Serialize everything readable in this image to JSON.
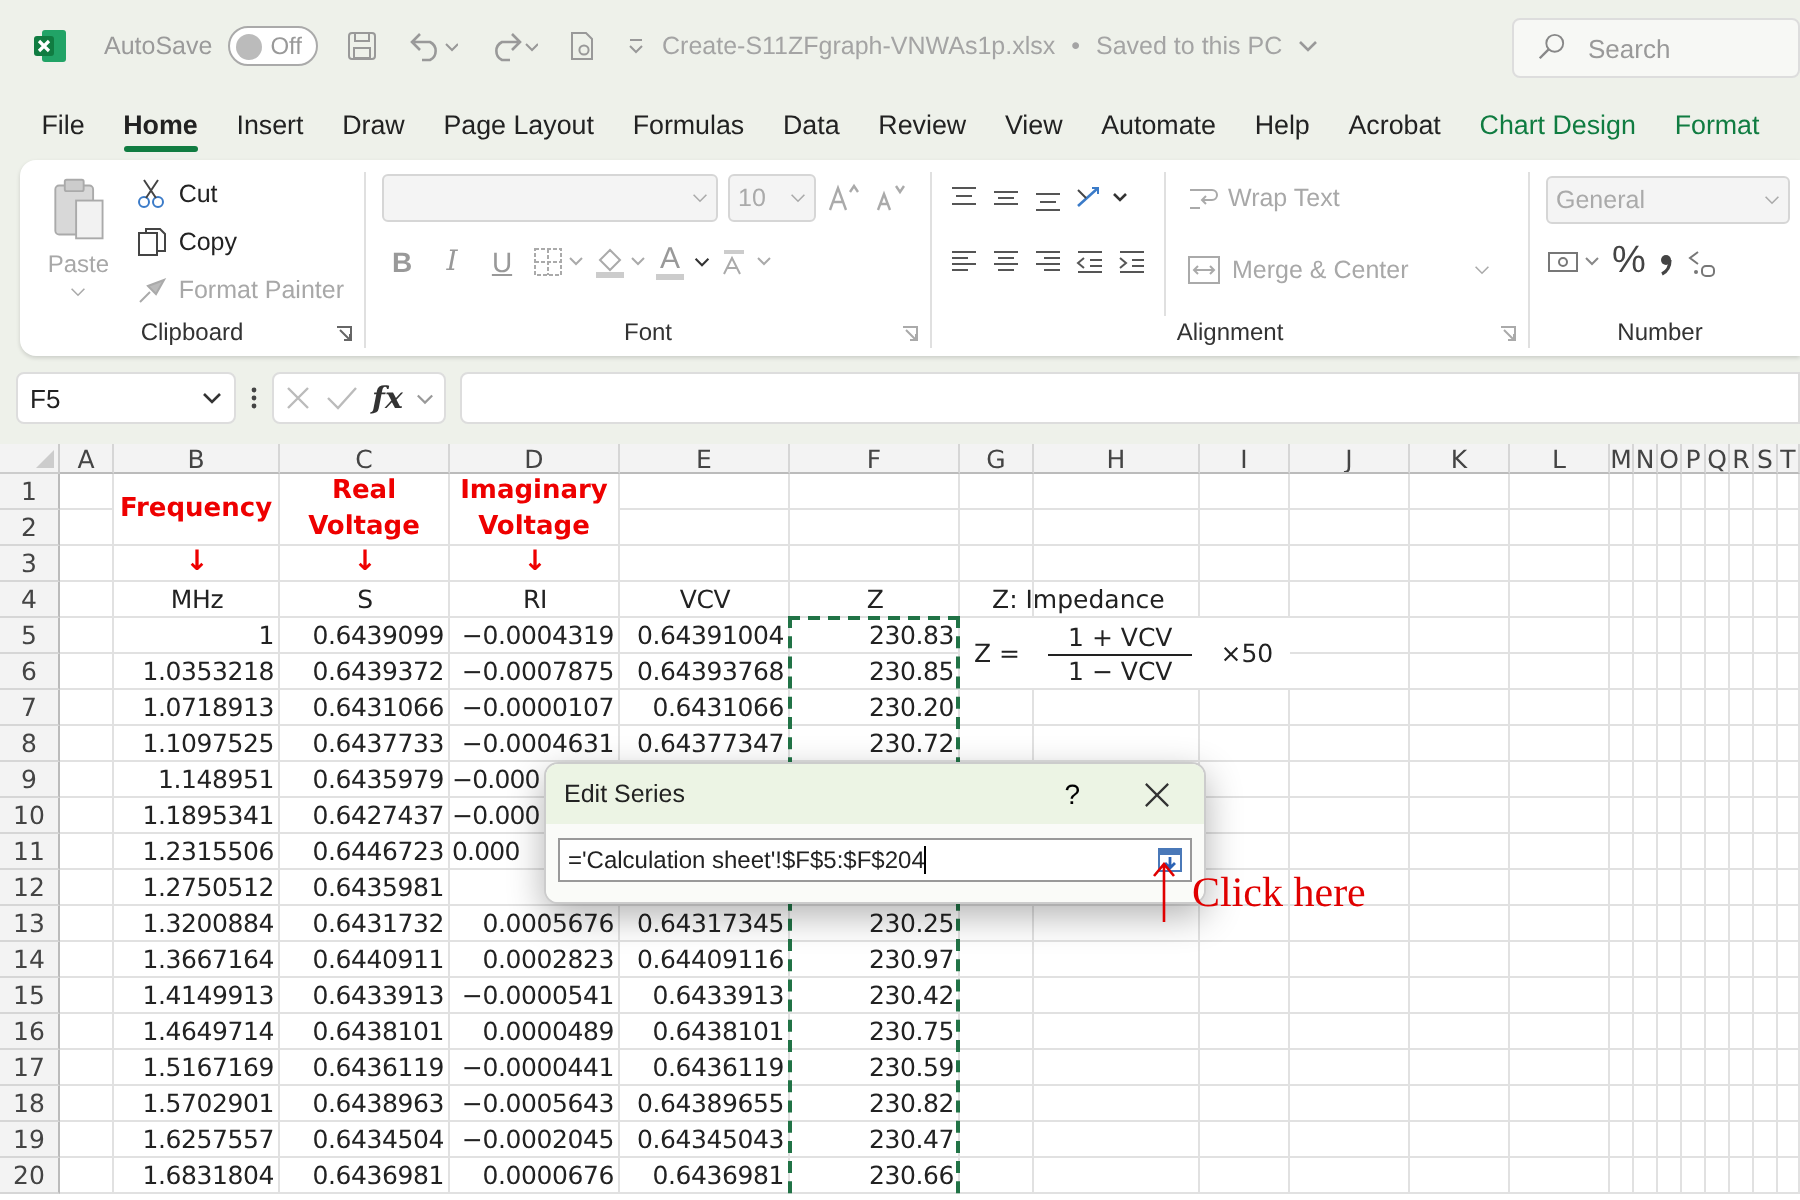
{
  "titlebar": {
    "autosave": "AutoSave",
    "autosave_state": "Off",
    "autosave_on": false,
    "filename": "Create-S11ZFgraph-VNWAs1p.xlsx",
    "separator": "•",
    "save_status": "Saved to this PC",
    "search": {
      "placeholder": "Search"
    }
  },
  "tabs": [
    {
      "label": "File",
      "selected": false,
      "contextual": false
    },
    {
      "label": "Home",
      "selected": true,
      "contextual": false
    },
    {
      "label": "Insert",
      "selected": false,
      "contextual": false
    },
    {
      "label": "Draw",
      "selected": false,
      "contextual": false
    },
    {
      "label": "Page Layout",
      "selected": false,
      "contextual": false
    },
    {
      "label": "Formulas",
      "selected": false,
      "contextual": false
    },
    {
      "label": "Data",
      "selected": false,
      "contextual": false
    },
    {
      "label": "Review",
      "selected": false,
      "contextual": false
    },
    {
      "label": "View",
      "selected": false,
      "contextual": false
    },
    {
      "label": "Automate",
      "selected": false,
      "contextual": false
    },
    {
      "label": "Help",
      "selected": false,
      "contextual": false
    },
    {
      "label": "Acrobat",
      "selected": false,
      "contextual": false
    },
    {
      "label": "Chart Design",
      "selected": false,
      "contextual": true
    },
    {
      "label": "Format",
      "selected": false,
      "contextual": true
    }
  ],
  "ribbon": {
    "clipboard": {
      "label": "Clipboard",
      "paste": {
        "label": "Paste",
        "disabled": true
      },
      "items": [
        {
          "label": "Cut",
          "disabled": false
        },
        {
          "label": "Copy",
          "disabled": false
        },
        {
          "label": "Format Painter",
          "disabled": true
        }
      ]
    },
    "font": {
      "label": "Font",
      "size": "10",
      "styles": [
        "B",
        "I",
        "U"
      ],
      "font_color": "A"
    },
    "alignment": {
      "label": "Alignment",
      "items": [
        {
          "label": "Wrap Text",
          "disabled": true
        },
        {
          "label": "Merge & Center",
          "disabled": true
        }
      ]
    },
    "number": {
      "label": "Number",
      "format": "General",
      "percent": "%"
    }
  },
  "formula_bar": {
    "name_box": "F5",
    "fx": "fx"
  },
  "columns": [
    "A",
    "B",
    "C",
    "D",
    "E",
    "F",
    "G",
    "H",
    "I",
    "J",
    "K",
    "L",
    "M",
    "N",
    "O",
    "P",
    "Q",
    "R",
    "S",
    "T"
  ],
  "headings": [
    {
      "lines": [
        "Frequency"
      ],
      "arrow": "↓"
    },
    {
      "lines": [
        "Real",
        "Voltage"
      ],
      "arrow": "↓"
    },
    {
      "lines": [
        "Imaginary",
        "Voltage"
      ],
      "arrow": "↓"
    }
  ],
  "rows": [
    {
      "number": "1",
      "kind": "heading"
    },
    {
      "number": "2",
      "kind": "heading"
    },
    {
      "number": "3",
      "kind": "heading"
    },
    {
      "number": "4",
      "kind": "units",
      "cells": [
        "MHz",
        "S",
        "RI",
        "VCV",
        "Z"
      ]
    },
    {
      "number": "5",
      "kind": "data",
      "cells": [
        "1",
        "0.6439099",
        "−0.0004319",
        "0.64391004",
        "230.83"
      ]
    },
    {
      "number": "6",
      "kind": "data",
      "cells": [
        "1.0353218",
        "0.6439372",
        "−0.0007875",
        "0.64393768",
        "230.85"
      ]
    },
    {
      "number": "7",
      "kind": "data",
      "cells": [
        "1.0718913",
        "0.6431066",
        "−0.0000107",
        "0.6431066",
        "230.20"
      ]
    },
    {
      "number": "8",
      "kind": "data",
      "cells": [
        "1.1097525",
        "0.6437733",
        "−0.0004631",
        "0.64377347",
        "230.72"
      ]
    },
    {
      "number": "9",
      "kind": "data",
      "cells": [
        "1.148951",
        "0.6435979",
        {
          "text": "−0.000",
          "cut": true
        }
      ]
    },
    {
      "number": "10",
      "kind": "data",
      "cells": [
        "1.1895341",
        "0.6427437",
        {
          "text": "−0.000",
          "cut": true
        }
      ]
    },
    {
      "number": "11",
      "kind": "data",
      "cells": [
        "1.2315506",
        "0.6446723",
        {
          "text": "0.000",
          "cut": true
        }
      ]
    },
    {
      "number": "12",
      "kind": "data",
      "cells": [
        "1.2750512",
        "0.6435981"
      ]
    },
    {
      "number": "13",
      "kind": "data",
      "cells": [
        "1.3200884",
        "0.6431732",
        "0.0005676",
        "0.64317345",
        "230.25"
      ]
    },
    {
      "number": "14",
      "kind": "data",
      "cells": [
        "1.3667164",
        "0.6440911",
        "0.0002823",
        "0.64409116",
        "230.97"
      ]
    },
    {
      "number": "15",
      "kind": "data",
      "cells": [
        "1.4149913",
        "0.6433913",
        "−0.0000541",
        "0.6433913",
        "230.42"
      ]
    },
    {
      "number": "16",
      "kind": "data",
      "cells": [
        "1.4649714",
        "0.6438101",
        "0.0000489",
        "0.6438101",
        "230.75"
      ]
    },
    {
      "number": "17",
      "kind": "data",
      "cells": [
        "1.5167169",
        "0.6436119",
        "−0.0000441",
        "0.6436119",
        "230.59"
      ]
    },
    {
      "number": "18",
      "kind": "data",
      "cells": [
        "1.5702901",
        "0.6438963",
        "−0.0005643",
        "0.64389655",
        "230.82"
      ]
    },
    {
      "number": "19",
      "kind": "data",
      "cells": [
        "1.6257557",
        "0.6434504",
        "−0.0002045",
        "0.64345043",
        "230.47"
      ]
    },
    {
      "number": "20",
      "kind": "data",
      "cells": [
        "1.6831804",
        "0.6436981",
        "0.0000676",
        "0.6436981",
        "230.66"
      ]
    }
  ],
  "note": {
    "title": "Z: Impedance",
    "lhs": "Z =",
    "numerator": "1 + VCV",
    "denominator": "1 − VCV",
    "factor": "×50"
  },
  "dialog": {
    "title": "Edit Series",
    "help": "?",
    "value": "='Calculation sheet'!$F$5:$F$204"
  },
  "annotation": {
    "text": "Click here"
  }
}
